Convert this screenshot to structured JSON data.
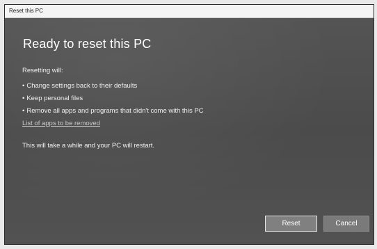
{
  "window": {
    "title": "Reset this PC"
  },
  "main": {
    "heading": "Ready to reset this PC",
    "intro": "Resetting will:",
    "bullets": [
      "Change settings back to their defaults",
      "Keep personal files",
      "Remove all apps and programs that didn't come with this PC"
    ],
    "apps_link": "List of apps to be removed",
    "restart_note": "This will take a while and your PC will restart."
  },
  "buttons": {
    "reset": "Reset",
    "cancel": "Cancel"
  },
  "colors": {
    "dialog_background": "#4b4b4b",
    "titlebar": "#f4f4f4",
    "text": "#ffffff",
    "button": "#808080"
  }
}
